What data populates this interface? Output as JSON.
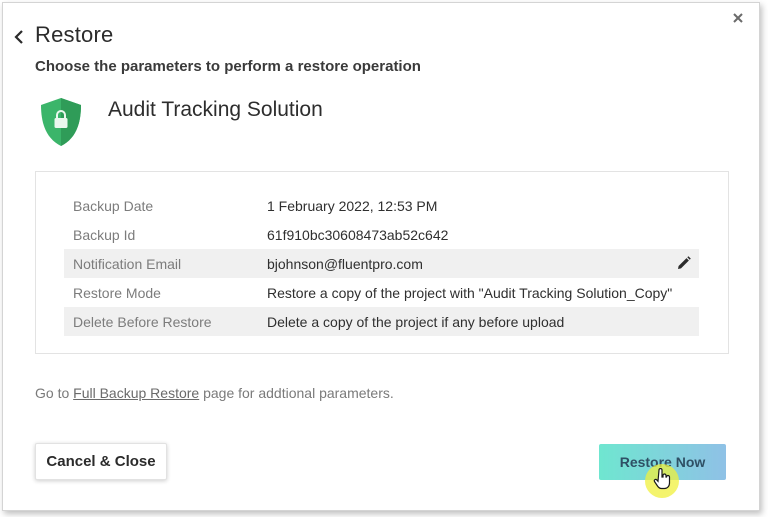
{
  "dialog": {
    "title": "Restore",
    "subtitle": "Choose the parameters to perform a restore operation",
    "back_icon": "chevron-left-icon",
    "close_icon": "close-icon"
  },
  "project": {
    "name": "Audit Tracking Solution",
    "icon": "shield-lock-icon",
    "icon_color": "#3bb56a"
  },
  "parameters": [
    {
      "label": "Backup Date",
      "value": "1 February 2022, 12:53 PM"
    },
    {
      "label": "Backup Id",
      "value": "61f910bc30608473ab52c642"
    },
    {
      "label": "Notification Email",
      "value": "bjohnson@fluentpro.com",
      "edit_icon": "pencil-icon"
    },
    {
      "label": "Restore Mode",
      "value": "Restore a copy of the project with \"Audit Tracking Solution_Copy\""
    },
    {
      "label": "Delete Before Restore",
      "value": "Delete a copy of the project if any before upload"
    }
  ],
  "footer": {
    "prefix": "Go to ",
    "link": "Full Backup Restore",
    "suffix": " page for addtional parameters."
  },
  "buttons": {
    "cancel": "Cancel & Close",
    "restore": "Restore Now"
  },
  "colors": {
    "restore_gradient_start": "#6fe6d0",
    "restore_gradient_end": "#8fc1e6",
    "cursor_highlight": "#f0f03c"
  }
}
